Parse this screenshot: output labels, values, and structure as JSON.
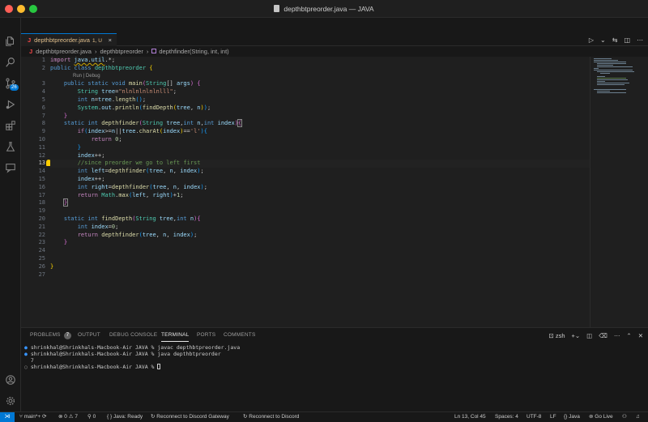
{
  "window": {
    "title": "depthbtpreorder.java — JAVA"
  },
  "tab": {
    "icon": "J",
    "name": "depthbtpreorder.java",
    "status": "1, U",
    "close": "×"
  },
  "breadcrumb": {
    "file": "depthbtpreorder.java",
    "class": "depthbtpreorder",
    "method": "depthfinder(String, int, int)"
  },
  "codelens": "Run | Debug",
  "editor": {
    "active_line": 13
  },
  "panel": {
    "tabs": [
      "PROBLEMS",
      "OUTPUT",
      "DEBUG CONSOLE",
      "TERMINAL",
      "PORTS",
      "COMMENTS"
    ],
    "problems_count": "7",
    "active_tab": "TERMINAL",
    "shell": "zsh"
  },
  "terminal": {
    "lines": [
      {
        "bullet": "●",
        "text": "shrinkhal@Shrinkhals-Macbook-Air JAVA % javac depthbtpreorder.java"
      },
      {
        "bullet": "●",
        "text": "shrinkhal@Shrinkhals-Macbook-Air JAVA % java depthbtpreorder"
      },
      {
        "bullet": "",
        "text": "7"
      },
      {
        "bullet": "○",
        "text": "shrinkhal@Shrinkhals-Macbook-Air JAVA % "
      }
    ]
  },
  "activity": {
    "source_control_badge": "26"
  },
  "status": {
    "branch": "main*+",
    "errors": "0",
    "warnings": "7",
    "ports": "0",
    "java": "Java: Ready",
    "discord1": "Reconnect to Discord Gateway",
    "discord2": "Reconnect to Discord",
    "position": "Ln 13, Col 45",
    "spaces": "Spaces: 4",
    "encoding": "UTF-8",
    "eol": "LF",
    "language": "Java",
    "golive": "Go Live"
  }
}
